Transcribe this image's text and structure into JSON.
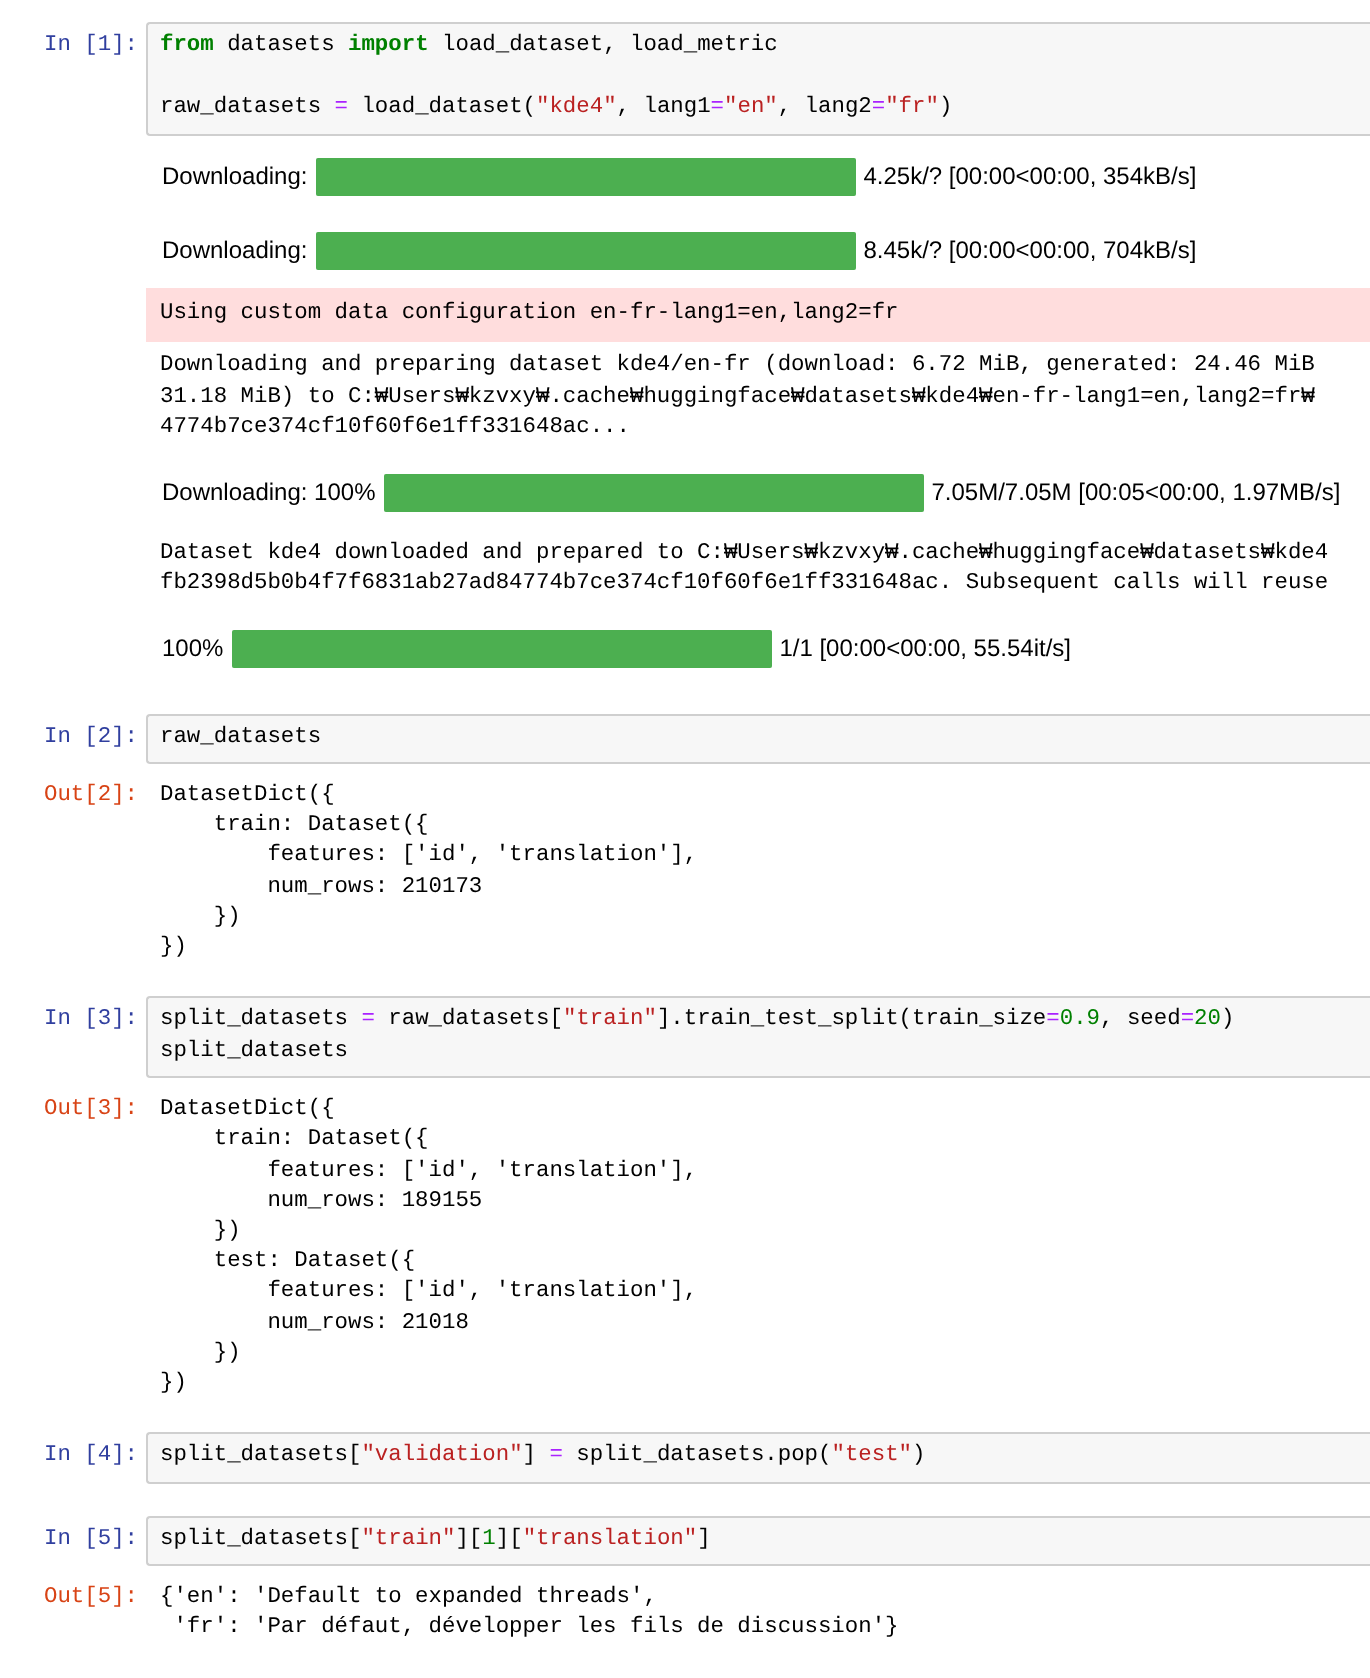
{
  "cells": [
    {
      "prompt": "In [1]:",
      "code_blocks": [
        {
          "lines": [
            {
              "tokens": [
                {
                  "kind": "keyword",
                  "text": "from"
                },
                {
                  "kind": "plain",
                  "text": " datasets "
                },
                {
                  "kind": "keyword",
                  "text": "import"
                },
                {
                  "kind": "plain",
                  "text": " load_dataset, load_metric"
                }
              ]
            }
          ]
        },
        {
          "lines": [
            {
              "tokens": [
                {
                  "kind": "plain",
                  "text": "raw_datasets "
                },
                {
                  "kind": "operator",
                  "text": "="
                },
                {
                  "kind": "plain",
                  "text": " load_dataset("
                },
                {
                  "kind": "string",
                  "text": "\"kde4\""
                },
                {
                  "kind": "plain",
                  "text": ", lang1"
                },
                {
                  "kind": "operator",
                  "text": "="
                },
                {
                  "kind": "string",
                  "text": "\"en\""
                },
                {
                  "kind": "plain",
                  "text": ", lang2"
                },
                {
                  "kind": "operator",
                  "text": "="
                },
                {
                  "kind": "string",
                  "text": "\"fr\""
                },
                {
                  "kind": "plain",
                  "text": ")"
                }
              ]
            }
          ]
        }
      ],
      "outputs": [
        {
          "kind": "progress",
          "label": "Downloading:",
          "level": 1,
          "reading": "4.25k/? [00:00<00:00, 354kB/s]"
        },
        {
          "kind": "progress",
          "label": "Downloading:",
          "level": 1,
          "reading": "8.45k/? [00:00<00:00, 704kB/s]"
        },
        {
          "kind": "stderr",
          "lines": [
            "Using custom data configuration en-fr-lang1=en,lang2=fr"
          ]
        },
        {
          "kind": "stdout",
          "lines": [
            "Downloading and preparing dataset kde4/en-fr (download: 6.72 MiB, generated: 24.46 MiB",
            "31.18 MiB) to C:₩Users₩kzvxy₩.cache₩huggingface₩datasets₩kde4₩en-fr-lang1=en,lang2=fr₩",
            "4774b7ce374cf10f60f6e1ff331648ac..."
          ]
        },
        {
          "kind": "progress",
          "label": "Downloading: 100%",
          "level": 1,
          "reading": "7.05M/7.05M [00:05<00:00, 1.97MB/s]"
        },
        {
          "kind": "stdout",
          "lines": [
            "Dataset kde4 downloaded and prepared to C:₩Users₩kzvxy₩.cache₩huggingface₩datasets₩kde4",
            "fb2398d5b0b4f7f6831ab27ad84774b7ce374cf10f60f6e1ff331648ac. Subsequent calls will reuse"
          ]
        },
        {
          "kind": "progress",
          "label": "100%",
          "level": 1,
          "reading": "1/1 [00:00<00:00, 55.54it/s]"
        }
      ]
    },
    {
      "prompt": "In [2]:",
      "code_blocks": [
        {
          "lines": [
            {
              "tokens": [
                {
                  "kind": "plain",
                  "text": "raw_datasets"
                }
              ]
            }
          ]
        }
      ],
      "outputs": [
        {
          "kind": "result",
          "prompt": "Out[2]:",
          "lines": [
            "DatasetDict({",
            "    train: Dataset({",
            "        features: ['id', 'translation'],",
            "        num_rows: 210173",
            "    })",
            "})"
          ]
        }
      ]
    },
    {
      "prompt": "In [3]:",
      "code_blocks": [
        {
          "lines": [
            {
              "tokens": [
                {
                  "kind": "plain",
                  "text": "split_datasets "
                },
                {
                  "kind": "operator",
                  "text": "="
                },
                {
                  "kind": "plain",
                  "text": " raw_datasets["
                },
                {
                  "kind": "string",
                  "text": "\"train\""
                },
                {
                  "kind": "plain",
                  "text": "].train_test_split(train_size"
                },
                {
                  "kind": "operator",
                  "text": "="
                },
                {
                  "kind": "number",
                  "text": "0.9"
                },
                {
                  "kind": "plain",
                  "text": ", seed"
                },
                {
                  "kind": "operator",
                  "text": "="
                },
                {
                  "kind": "number",
                  "text": "20"
                },
                {
                  "kind": "plain",
                  "text": ")"
                }
              ]
            },
            {
              "tokens": [
                {
                  "kind": "plain",
                  "text": "split_datasets"
                }
              ]
            }
          ]
        }
      ],
      "outputs": [
        {
          "kind": "result",
          "prompt": "Out[3]:",
          "lines": [
            "DatasetDict({",
            "    train: Dataset({",
            "        features: ['id', 'translation'],",
            "        num_rows: 189155",
            "    })",
            "    test: Dataset({",
            "        features: ['id', 'translation'],",
            "        num_rows: 21018",
            "    })",
            "})"
          ]
        }
      ]
    },
    {
      "prompt": "In [4]:",
      "code_blocks": [
        {
          "lines": [
            {
              "tokens": [
                {
                  "kind": "plain",
                  "text": "split_datasets["
                },
                {
                  "kind": "string",
                  "text": "\"validation\""
                },
                {
                  "kind": "plain",
                  "text": "] "
                },
                {
                  "kind": "operator",
                  "text": "="
                },
                {
                  "kind": "plain",
                  "text": " split_datasets.pop("
                },
                {
                  "kind": "string",
                  "text": "\"test\""
                },
                {
                  "kind": "plain",
                  "text": ")"
                }
              ]
            }
          ]
        }
      ]
    },
    {
      "prompt": "In [5]:",
      "code_blocks": [
        {
          "lines": [
            {
              "tokens": [
                {
                  "kind": "plain",
                  "text": "split_datasets["
                },
                {
                  "kind": "string",
                  "text": "\"train\""
                },
                {
                  "kind": "plain",
                  "text": "]["
                },
                {
                  "kind": "number",
                  "text": "1"
                },
                {
                  "kind": "plain",
                  "text": "]["
                },
                {
                  "kind": "string",
                  "text": "\"translation\""
                },
                {
                  "kind": "plain",
                  "text": "]"
                }
              ]
            }
          ]
        }
      ],
      "outputs": [
        {
          "kind": "result",
          "prompt": "Out[5]:",
          "lines": [
            "{'en': 'Default to expanded threads',",
            " 'fr': 'Par défaut, développer les fils de discussion'}"
          ]
        }
      ]
    }
  ]
}
